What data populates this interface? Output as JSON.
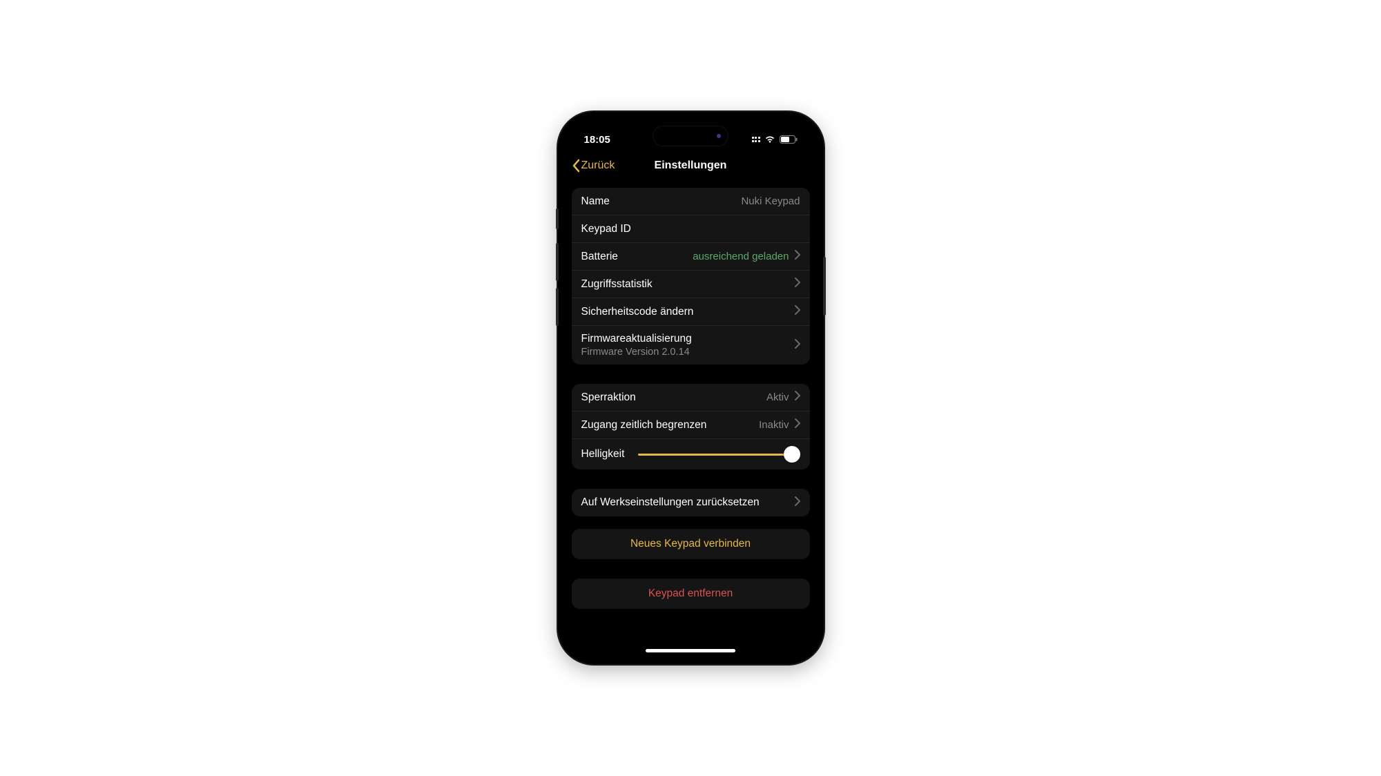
{
  "status": {
    "time": "18:05"
  },
  "nav": {
    "back": "Zurück",
    "title": "Einstellungen"
  },
  "group1": {
    "name_label": "Name",
    "name_value": "Nuki Keypad",
    "keypad_id_label": "Keypad ID",
    "battery_label": "Batterie",
    "battery_value": "ausreichend geladen",
    "stats_label": "Zugriffsstatistik",
    "code_label": "Sicherheitscode ändern",
    "firmware_label": "Firmwareaktualisierung",
    "firmware_sub": "Firmware Version 2.0.14"
  },
  "group2": {
    "lock_label": "Sperraktion",
    "lock_value": "Aktiv",
    "time_label": "Zugang zeitlich begrenzen",
    "time_value": "Inaktiv",
    "brightness_label": "Helligkeit",
    "brightness_percent": 95
  },
  "group3": {
    "reset_label": "Auf Werkseinstellungen zurücksetzen"
  },
  "actions": {
    "connect": "Neues Keypad verbinden",
    "remove": "Keypad entfernen"
  }
}
